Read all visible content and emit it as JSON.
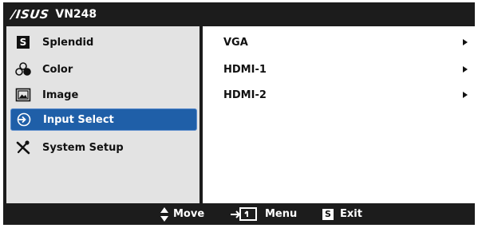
{
  "title": {
    "brand": "/ISUS",
    "model": "VN248"
  },
  "sidebar": {
    "items": [
      {
        "label": "Splendid",
        "icon": "splendid-s-icon",
        "glyph": "S"
      },
      {
        "label": "Color",
        "icon": "color-palette-icon"
      },
      {
        "label": "Image",
        "icon": "image-icon"
      },
      {
        "label": "Input Select",
        "icon": "input-select-icon",
        "selected": true
      },
      {
        "label": "System Setup",
        "icon": "system-setup-tools-icon"
      }
    ]
  },
  "content": {
    "items": [
      {
        "label": "VGA"
      },
      {
        "label": "HDMI-1"
      },
      {
        "label": "HDMI-2"
      }
    ]
  },
  "footer": {
    "move_label": "Move",
    "menu_label": "Menu",
    "exit_glyph": "S",
    "exit_label": "Exit"
  },
  "colors": {
    "selected_bg": "#1f5fa8",
    "frame": "#1c1c1c",
    "sidebar_bg": "#e3e3e3"
  }
}
